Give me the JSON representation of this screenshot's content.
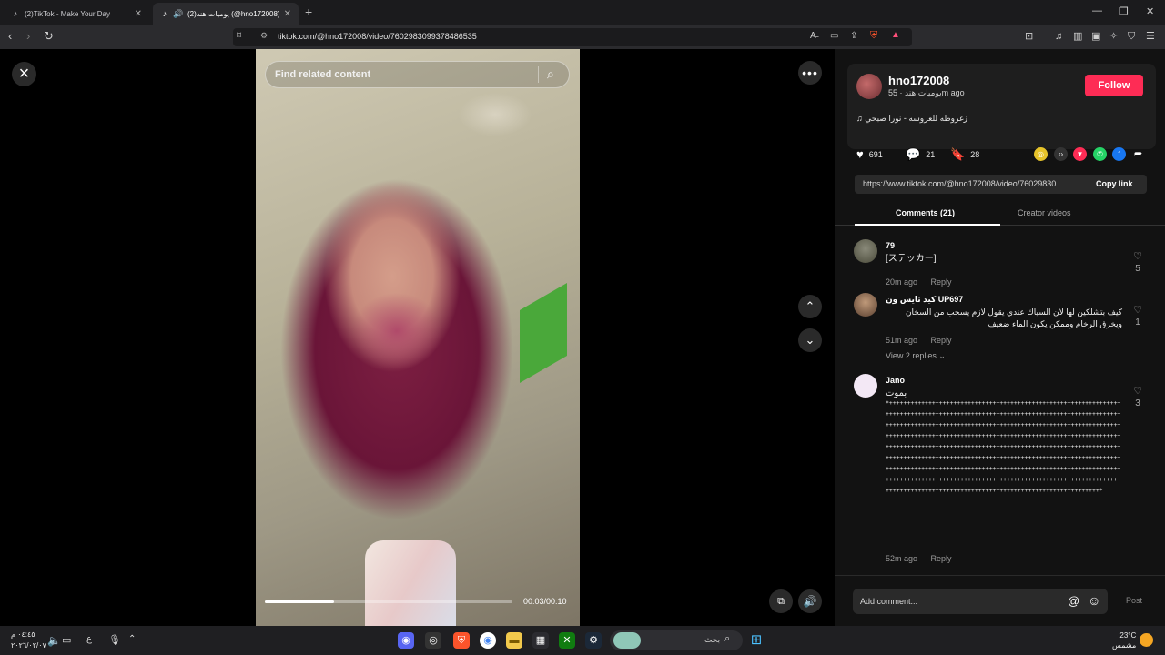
{
  "browser": {
    "tabs": [
      {
        "title": "(2)TikTok - Make Your Day",
        "active": false
      },
      {
        "title": "(2)يوميات هند (@hno172008)",
        "active": true
      }
    ],
    "url": "tiktok.com/@hno172008/video/7602983099378486535"
  },
  "video": {
    "search_placeholder": "Find related content",
    "time": "00:03/00:10",
    "progress": 0.28
  },
  "creator": {
    "username": "hno172008",
    "subtitle": "يوميات هند · 55m ago",
    "follow_label": "Follow",
    "music": "زغروطه للعروسه - نورا صبحي"
  },
  "stats": {
    "likes": "691",
    "comments": "21",
    "saves": "28"
  },
  "share": {
    "link": "https://www.tiktok.com/@hno172008/video/76029830...",
    "copy_label": "Copy link"
  },
  "panel_tabs": {
    "comments": "Comments (21)",
    "creator": "Creator videos"
  },
  "comments": [
    {
      "user": "79",
      "text": "[ステッカー]",
      "time": "20m ago",
      "reply": "Reply",
      "likes": "5"
    },
    {
      "user": "كيد تايس ون UP697",
      "text": "كيف بتشلكين لها لان السياك عندي يقول لازم يسحب من السخان ويخرق الرخام وممكن يكون الماء ضعيف",
      "time": "51m ago",
      "reply": "Reply",
      "likes": "1",
      "view_replies": "View 2 replies"
    },
    {
      "user": "Jano",
      "text": "بموت",
      "long": "*+++++++++++++++++++++++++++++++++++++++++++++++++++++++++++++++++++++++++++++++++++++++++++++++++++++++++++++++++++++++++++++++++++++++++++++++++++++++++++++++++++++++++++++++++++++++++++++++++++++++++++++++++++++++++++++++++++++++++++++++++++++++++++++++++++++++++++++++++++++++++++++++++++++++++++++++++++++++++++++++++++++++++++++++++++++++++++++++++++++++++++++++++++++++++++++++++++++++++++++++++++++++++++++++++++++++++++++++++++++++++++++++++++++++++++++++++++++++++++++++++++++++++++++++++++++++++++++++++++++++++++++++++++++++++++++++++++++++++++++++++++++++++++++++++++++++++++*",
      "time": "52m ago",
      "reply": "Reply",
      "likes": "3"
    }
  ],
  "comment_input": {
    "placeholder": "Add comment...",
    "post_label": "Post"
  },
  "taskbar": {
    "search_placeholder": "بحث",
    "time": "٠٤:٤٥ م",
    "date": "٢٠٢٦/٠٢/٠٧",
    "lang": "ع",
    "temp": "23°C",
    "weather": "مشمس"
  },
  "colors": {
    "follow": "#fe2c55",
    "panel_bg": "#121212"
  }
}
